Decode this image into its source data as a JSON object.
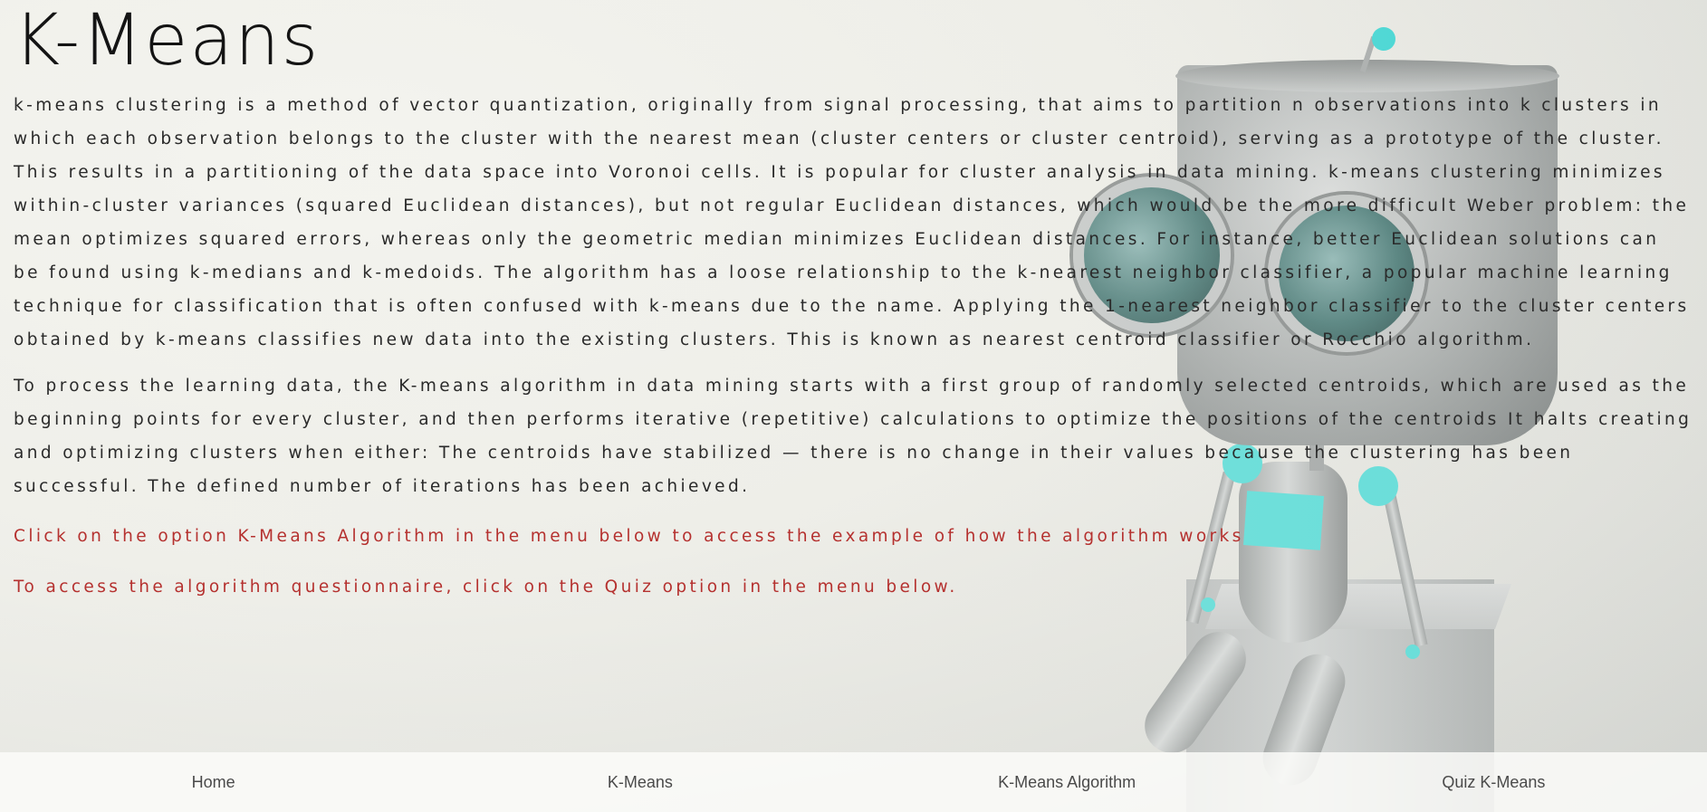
{
  "header": {
    "title": "K-Means"
  },
  "main": {
    "paragraphs": [
      "k-means clustering is a method of vector quantization, originally from signal processing, that aims to partition n observations into k clusters in which each observation belongs to the cluster with the nearest mean (cluster centers or cluster centroid), serving as a prototype of the cluster. This results in a partitioning of the data space into Voronoi cells. It is popular for cluster analysis in data mining. k-means clustering minimizes within-cluster variances (squared Euclidean distances), but not regular Euclidean distances, which would be the more difficult Weber problem: the mean optimizes squared errors, whereas only the geometric median minimizes Euclidean distances. For instance, better Euclidean solutions can be found using k-medians and k-medoids. The algorithm has a loose relationship to the k-nearest neighbor classifier, a popular machine learning technique for classification that is often confused with k-means due to the name. Applying the 1-nearest neighbor classifier to the cluster centers obtained by k-means classifies new data into the existing clusters. This is known as nearest centroid classifier or Rocchio algorithm.",
      "To process the learning data, the K-means algorithm in data mining starts with a first group of randomly selected centroids, which are used as the beginning points for every cluster, and then performs iterative (repetitive) calculations to optimize the positions of the centroids It halts creating and optimizing clusters when either: The centroids have stabilized — there is no change in their values because the clustering has been successful. The defined number of iterations has been achieved."
    ],
    "notices": [
      "Click on the option K-Means Algorithm in the menu below to access the example of how the algorithm works",
      "To access the algorithm questionnaire, click on the Quiz option in the menu below."
    ]
  },
  "nav": {
    "items": [
      "Home",
      "K-Means",
      "K-Means Algorithm",
      "Quiz K-Means"
    ]
  },
  "colors": {
    "notice_text": "#b5312f",
    "accent_cyan": "#5ddcd7"
  },
  "background": {
    "image": "robot-illustration"
  }
}
